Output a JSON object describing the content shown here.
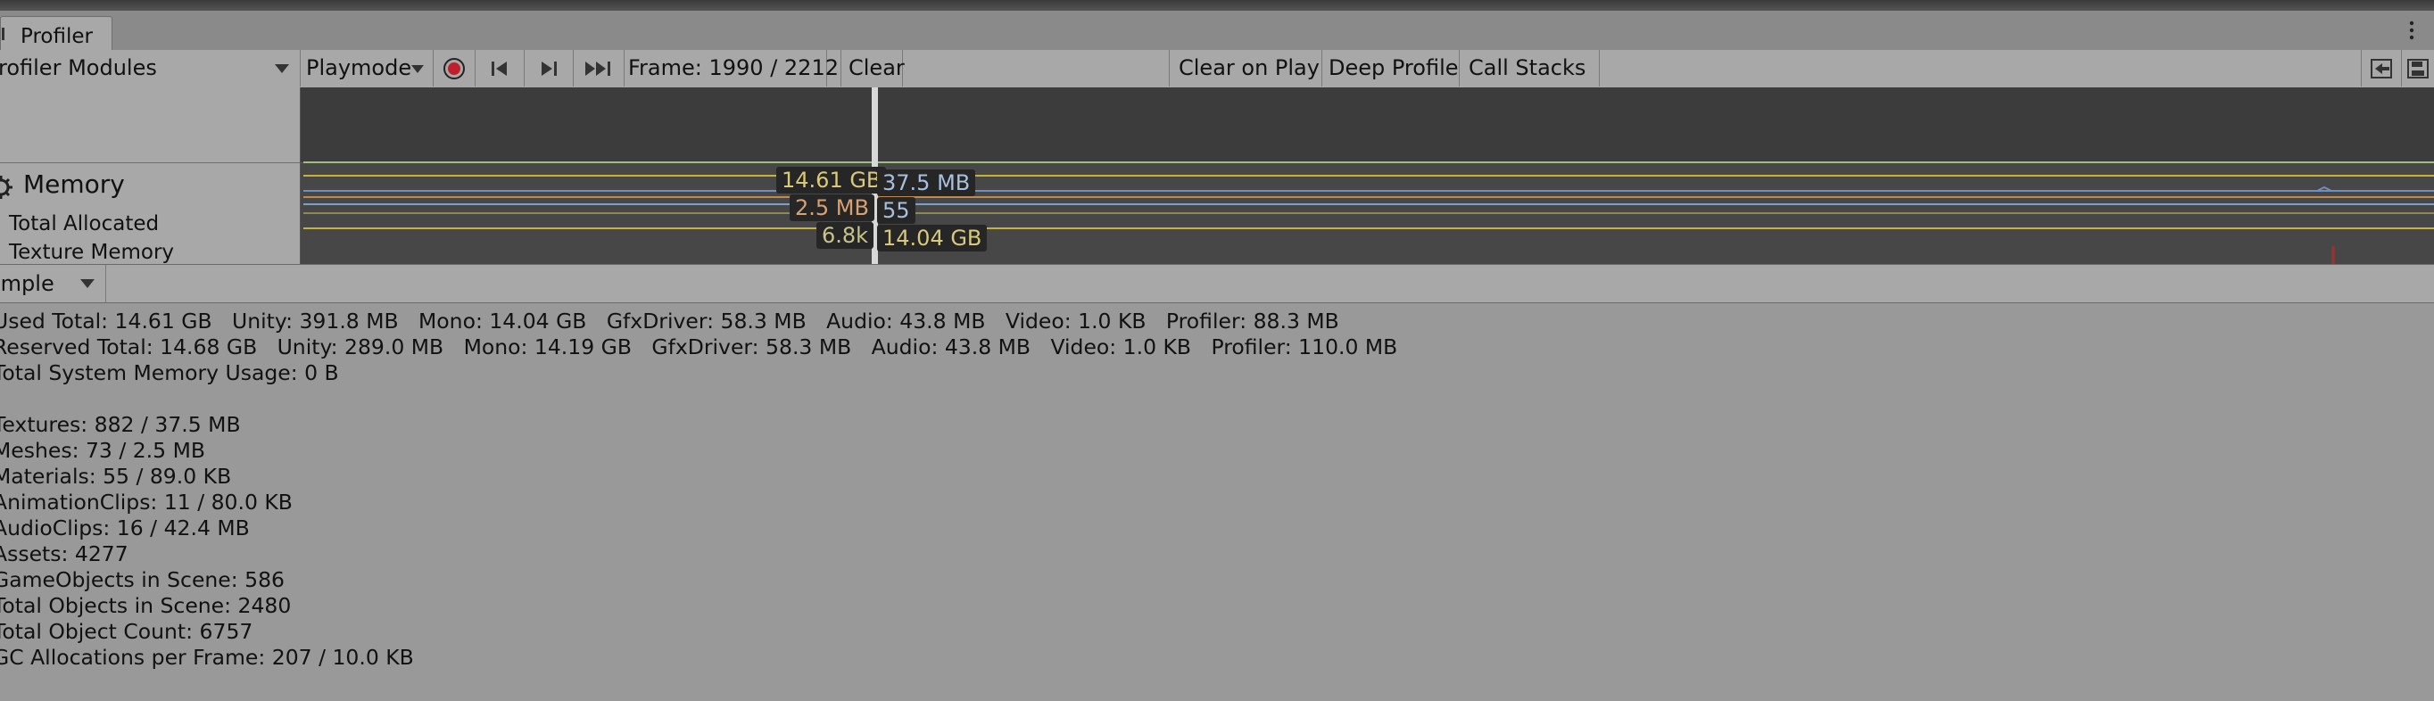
{
  "window": {
    "tab_title": "Profiler"
  },
  "toolbar": {
    "modules_dropdown": "rofiler Modules",
    "playmode_dropdown": "Playmode",
    "frame_label": "Frame: 1990 / 2212",
    "clear": "Clear",
    "clear_on_play": "Clear on Play",
    "deep_profile": "Deep Profile",
    "call_stacks": "Call Stacks"
  },
  "module": {
    "title": "Memory",
    "legend": [
      "Total Allocated",
      "Texture Memory"
    ]
  },
  "chart_tooltips": {
    "left": [
      "14.61 GB",
      "2.5 MB",
      "6.8k"
    ],
    "right": [
      "37.5 MB",
      "55",
      "14.04 GB"
    ]
  },
  "details": {
    "view_mode": "imple",
    "lines": [
      "Used Total: 14.61 GB   Unity: 391.8 MB   Mono: 14.04 GB   GfxDriver: 58.3 MB   Audio: 43.8 MB   Video: 1.0 KB   Profiler: 88.3 MB",
      "Reserved Total: 14.68 GB   Unity: 289.0 MB   Mono: 14.19 GB   GfxDriver: 58.3 MB   Audio: 43.8 MB   Video: 1.0 KB   Profiler: 110.0 MB",
      "Total System Memory Usage: 0 B",
      "",
      "Textures: 882 / 37.5 MB",
      "Meshes: 73 / 2.5 MB",
      "Materials: 55 / 89.0 KB",
      "AnimationClips: 11 / 80.0 KB",
      "AudioClips: 16 / 42.4 MB",
      "Assets: 4277",
      "GameObjects in Scene: 586",
      "Total Objects in Scene: 2480",
      "Total Object Count: 6757",
      "GC Allocations per Frame: 207 / 10.0 KB"
    ]
  },
  "colors": {
    "background": "#999999",
    "chart_bg": "#474747",
    "line_green": "#9ec07c",
    "line_yellow": "#c8b33a",
    "line_blue": "#6f8fc0",
    "line_orange": "#c08a4a",
    "record_red": "#c0202a"
  }
}
